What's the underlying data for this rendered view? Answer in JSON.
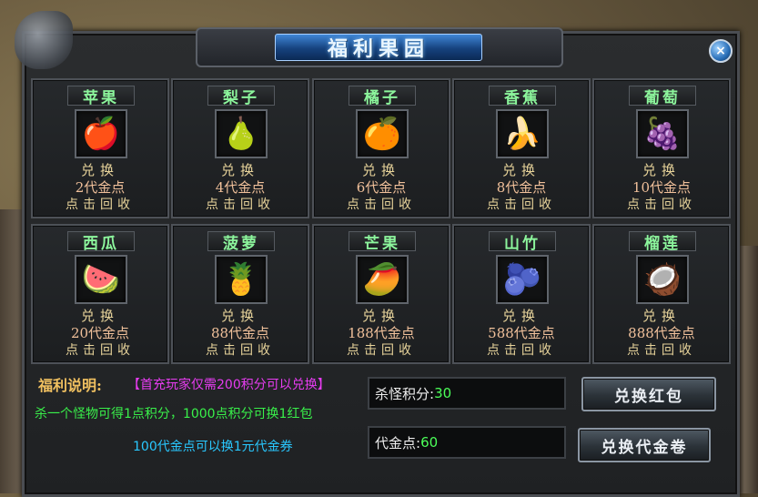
{
  "window": {
    "title": "福利果园",
    "close_icon": "×"
  },
  "fruits": [
    {
      "name": "苹果",
      "icon": "🍎",
      "exchange": "兑换",
      "cost": "2代金点",
      "action": "点击回收"
    },
    {
      "name": "梨子",
      "icon": "🍐",
      "exchange": "兑换",
      "cost": "4代金点",
      "action": "点击回收"
    },
    {
      "name": "橘子",
      "icon": "🍊",
      "exchange": "兑换",
      "cost": "6代金点",
      "action": "点击回收"
    },
    {
      "name": "香蕉",
      "icon": "🍌",
      "exchange": "兑换",
      "cost": "8代金点",
      "action": "点击回收"
    },
    {
      "name": "葡萄",
      "icon": "🍇",
      "exchange": "兑换",
      "cost": "10代金点",
      "action": "点击回收"
    },
    {
      "name": "西瓜",
      "icon": "🍉",
      "exchange": "兑换",
      "cost": "20代金点",
      "action": "点击回收"
    },
    {
      "name": "菠萝",
      "icon": "🍍",
      "exchange": "兑换",
      "cost": "88代金点",
      "action": "点击回收"
    },
    {
      "name": "芒果",
      "icon": "🥭",
      "exchange": "兑换",
      "cost": "188代金点",
      "action": "点击回收"
    },
    {
      "name": "山竹",
      "icon": "🫐",
      "exchange": "兑换",
      "cost": "588代金点",
      "action": "点击回收"
    },
    {
      "name": "榴莲",
      "icon": "🥥",
      "exchange": "兑换",
      "cost": "888代金点",
      "action": "点击回收"
    }
  ],
  "footer": {
    "notice_label": "福利说明:",
    "notice_text": "【首充玩家仅需200积分可以兑换】",
    "rule1": "杀一个怪物可得1点积分，1000点积分可换1红包",
    "rule2": "100代金点可以换1元代金券",
    "kill_points_label": "杀怪积分:",
    "kill_points_value": "30",
    "coupon_points_label": "代金点:",
    "coupon_points_value": "60",
    "redeem_red_packet": "兑换红包",
    "redeem_voucher": "兑换代金卷"
  },
  "colors": {
    "name": "#8cf59c",
    "cost": "#f0c09a",
    "notice_text": "#e63cf0",
    "rule1": "#39f04a",
    "rule2": "#29c8ff",
    "value": "#4cff59"
  }
}
